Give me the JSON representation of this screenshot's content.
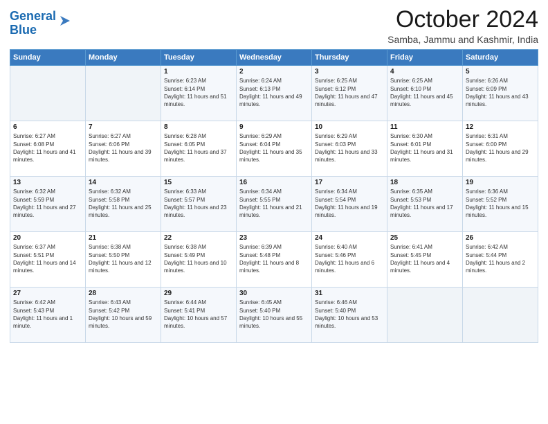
{
  "header": {
    "logo_line1": "General",
    "logo_line2": "Blue",
    "month": "October 2024",
    "location": "Samba, Jammu and Kashmir, India"
  },
  "days_of_week": [
    "Sunday",
    "Monday",
    "Tuesday",
    "Wednesday",
    "Thursday",
    "Friday",
    "Saturday"
  ],
  "weeks": [
    [
      {
        "day": "",
        "sunrise": "",
        "sunset": "",
        "daylight": ""
      },
      {
        "day": "",
        "sunrise": "",
        "sunset": "",
        "daylight": ""
      },
      {
        "day": "1",
        "sunrise": "Sunrise: 6:23 AM",
        "sunset": "Sunset: 6:14 PM",
        "daylight": "Daylight: 11 hours and 51 minutes."
      },
      {
        "day": "2",
        "sunrise": "Sunrise: 6:24 AM",
        "sunset": "Sunset: 6:13 PM",
        "daylight": "Daylight: 11 hours and 49 minutes."
      },
      {
        "day": "3",
        "sunrise": "Sunrise: 6:25 AM",
        "sunset": "Sunset: 6:12 PM",
        "daylight": "Daylight: 11 hours and 47 minutes."
      },
      {
        "day": "4",
        "sunrise": "Sunrise: 6:25 AM",
        "sunset": "Sunset: 6:10 PM",
        "daylight": "Daylight: 11 hours and 45 minutes."
      },
      {
        "day": "5",
        "sunrise": "Sunrise: 6:26 AM",
        "sunset": "Sunset: 6:09 PM",
        "daylight": "Daylight: 11 hours and 43 minutes."
      }
    ],
    [
      {
        "day": "6",
        "sunrise": "Sunrise: 6:27 AM",
        "sunset": "Sunset: 6:08 PM",
        "daylight": "Daylight: 11 hours and 41 minutes."
      },
      {
        "day": "7",
        "sunrise": "Sunrise: 6:27 AM",
        "sunset": "Sunset: 6:06 PM",
        "daylight": "Daylight: 11 hours and 39 minutes."
      },
      {
        "day": "8",
        "sunrise": "Sunrise: 6:28 AM",
        "sunset": "Sunset: 6:05 PM",
        "daylight": "Daylight: 11 hours and 37 minutes."
      },
      {
        "day": "9",
        "sunrise": "Sunrise: 6:29 AM",
        "sunset": "Sunset: 6:04 PM",
        "daylight": "Daylight: 11 hours and 35 minutes."
      },
      {
        "day": "10",
        "sunrise": "Sunrise: 6:29 AM",
        "sunset": "Sunset: 6:03 PM",
        "daylight": "Daylight: 11 hours and 33 minutes."
      },
      {
        "day": "11",
        "sunrise": "Sunrise: 6:30 AM",
        "sunset": "Sunset: 6:01 PM",
        "daylight": "Daylight: 11 hours and 31 minutes."
      },
      {
        "day": "12",
        "sunrise": "Sunrise: 6:31 AM",
        "sunset": "Sunset: 6:00 PM",
        "daylight": "Daylight: 11 hours and 29 minutes."
      }
    ],
    [
      {
        "day": "13",
        "sunrise": "Sunrise: 6:32 AM",
        "sunset": "Sunset: 5:59 PM",
        "daylight": "Daylight: 11 hours and 27 minutes."
      },
      {
        "day": "14",
        "sunrise": "Sunrise: 6:32 AM",
        "sunset": "Sunset: 5:58 PM",
        "daylight": "Daylight: 11 hours and 25 minutes."
      },
      {
        "day": "15",
        "sunrise": "Sunrise: 6:33 AM",
        "sunset": "Sunset: 5:57 PM",
        "daylight": "Daylight: 11 hours and 23 minutes."
      },
      {
        "day": "16",
        "sunrise": "Sunrise: 6:34 AM",
        "sunset": "Sunset: 5:55 PM",
        "daylight": "Daylight: 11 hours and 21 minutes."
      },
      {
        "day": "17",
        "sunrise": "Sunrise: 6:34 AM",
        "sunset": "Sunset: 5:54 PM",
        "daylight": "Daylight: 11 hours and 19 minutes."
      },
      {
        "day": "18",
        "sunrise": "Sunrise: 6:35 AM",
        "sunset": "Sunset: 5:53 PM",
        "daylight": "Daylight: 11 hours and 17 minutes."
      },
      {
        "day": "19",
        "sunrise": "Sunrise: 6:36 AM",
        "sunset": "Sunset: 5:52 PM",
        "daylight": "Daylight: 11 hours and 15 minutes."
      }
    ],
    [
      {
        "day": "20",
        "sunrise": "Sunrise: 6:37 AM",
        "sunset": "Sunset: 5:51 PM",
        "daylight": "Daylight: 11 hours and 14 minutes."
      },
      {
        "day": "21",
        "sunrise": "Sunrise: 6:38 AM",
        "sunset": "Sunset: 5:50 PM",
        "daylight": "Daylight: 11 hours and 12 minutes."
      },
      {
        "day": "22",
        "sunrise": "Sunrise: 6:38 AM",
        "sunset": "Sunset: 5:49 PM",
        "daylight": "Daylight: 11 hours and 10 minutes."
      },
      {
        "day": "23",
        "sunrise": "Sunrise: 6:39 AM",
        "sunset": "Sunset: 5:48 PM",
        "daylight": "Daylight: 11 hours and 8 minutes."
      },
      {
        "day": "24",
        "sunrise": "Sunrise: 6:40 AM",
        "sunset": "Sunset: 5:46 PM",
        "daylight": "Daylight: 11 hours and 6 minutes."
      },
      {
        "day": "25",
        "sunrise": "Sunrise: 6:41 AM",
        "sunset": "Sunset: 5:45 PM",
        "daylight": "Daylight: 11 hours and 4 minutes."
      },
      {
        "day": "26",
        "sunrise": "Sunrise: 6:42 AM",
        "sunset": "Sunset: 5:44 PM",
        "daylight": "Daylight: 11 hours and 2 minutes."
      }
    ],
    [
      {
        "day": "27",
        "sunrise": "Sunrise: 6:42 AM",
        "sunset": "Sunset: 5:43 PM",
        "daylight": "Daylight: 11 hours and 1 minute."
      },
      {
        "day": "28",
        "sunrise": "Sunrise: 6:43 AM",
        "sunset": "Sunset: 5:42 PM",
        "daylight": "Daylight: 10 hours and 59 minutes."
      },
      {
        "day": "29",
        "sunrise": "Sunrise: 6:44 AM",
        "sunset": "Sunset: 5:41 PM",
        "daylight": "Daylight: 10 hours and 57 minutes."
      },
      {
        "day": "30",
        "sunrise": "Sunrise: 6:45 AM",
        "sunset": "Sunset: 5:40 PM",
        "daylight": "Daylight: 10 hours and 55 minutes."
      },
      {
        "day": "31",
        "sunrise": "Sunrise: 6:46 AM",
        "sunset": "Sunset: 5:40 PM",
        "daylight": "Daylight: 10 hours and 53 minutes."
      },
      {
        "day": "",
        "sunrise": "",
        "sunset": "",
        "daylight": ""
      },
      {
        "day": "",
        "sunrise": "",
        "sunset": "",
        "daylight": ""
      }
    ]
  ]
}
